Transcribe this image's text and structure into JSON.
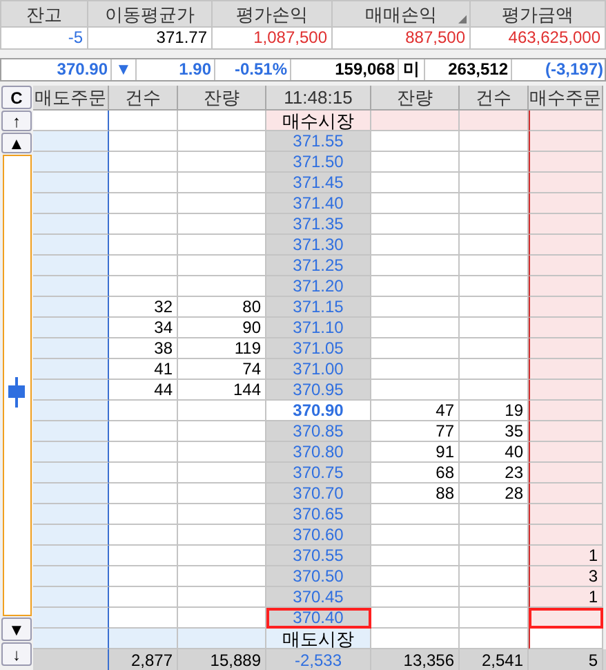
{
  "position": {
    "columns": [
      "잔고",
      "이동평균가",
      "평가손익",
      "매매손익",
      "평가금액"
    ],
    "values": [
      {
        "text": "-5",
        "color": "#2f6fe0"
      },
      {
        "text": "371.77",
        "color": "#000000"
      },
      {
        "text": "1,087,500",
        "color": "#e03030"
      },
      {
        "text": "887,500",
        "color": "#e03030"
      },
      {
        "text": "463,625,000",
        "color": "#e03030"
      }
    ]
  },
  "quote_bar": [
    {
      "text": "370.90",
      "color": "#2f6fe0"
    },
    {
      "text": "▼",
      "color": "#2f6fe0"
    },
    {
      "text": "1.90",
      "color": "#2f6fe0"
    },
    {
      "text": "-0.51%",
      "color": "#2f6fe0"
    },
    {
      "text": "159,068",
      "color": "#000000"
    },
    {
      "text": "미",
      "color": "#000000"
    },
    {
      "text": "263,512",
      "color": "#000000"
    },
    {
      "text": "(-3,197)",
      "color": "#2f6fe0"
    }
  ],
  "order_book": {
    "buttons": [
      "C",
      "↑",
      "▲",
      "▼",
      "↓"
    ],
    "columns": [
      "매도주문",
      "건수",
      "잔량",
      "11:48:15",
      "잔량",
      "건수",
      "매수주문"
    ],
    "rows": [
      {
        "kind": "market_buy",
        "price": "매수시장"
      },
      {
        "kind": "price",
        "price": "371.55",
        "current": false,
        "highlighted": false
      },
      {
        "kind": "price",
        "price": "371.50",
        "current": false,
        "highlighted": false
      },
      {
        "kind": "price",
        "price": "371.45",
        "current": false,
        "highlighted": false
      },
      {
        "kind": "price",
        "price": "371.40",
        "current": false,
        "highlighted": false
      },
      {
        "kind": "price",
        "price": "371.35",
        "current": false,
        "highlighted": false
      },
      {
        "kind": "price",
        "price": "371.30",
        "current": false,
        "highlighted": false
      },
      {
        "kind": "price",
        "price": "371.25",
        "current": false,
        "highlighted": false
      },
      {
        "kind": "price",
        "price": "371.20",
        "current": false,
        "highlighted": false
      },
      {
        "kind": "price",
        "left_count": "32",
        "left_qty": "80",
        "price": "371.15",
        "current": false,
        "highlighted": false
      },
      {
        "kind": "price",
        "left_count": "34",
        "left_qty": "90",
        "price": "371.10",
        "current": false,
        "highlighted": false
      },
      {
        "kind": "price",
        "left_count": "38",
        "left_qty": "119",
        "price": "371.05",
        "current": false,
        "highlighted": false
      },
      {
        "kind": "price",
        "left_count": "41",
        "left_qty": "74",
        "price": "371.00",
        "current": false,
        "highlighted": false
      },
      {
        "kind": "price",
        "left_count": "44",
        "left_qty": "144",
        "price": "370.95",
        "current": false,
        "highlighted": false
      },
      {
        "kind": "price",
        "price": "370.90",
        "right_qty": "47",
        "right_count": "19",
        "current": true,
        "highlighted": false
      },
      {
        "kind": "price",
        "price": "370.85",
        "right_qty": "77",
        "right_count": "35",
        "current": false,
        "highlighted": false
      },
      {
        "kind": "price",
        "price": "370.80",
        "right_qty": "91",
        "right_count": "40",
        "current": false,
        "highlighted": false
      },
      {
        "kind": "price",
        "price": "370.75",
        "right_qty": "68",
        "right_count": "23",
        "current": false,
        "highlighted": false
      },
      {
        "kind": "price",
        "price": "370.70",
        "right_qty": "88",
        "right_count": "28",
        "current": false,
        "highlighted": false
      },
      {
        "kind": "price",
        "price": "370.65",
        "current": false,
        "highlighted": false
      },
      {
        "kind": "price",
        "price": "370.60",
        "current": false,
        "highlighted": false
      },
      {
        "kind": "price",
        "price": "370.55",
        "buy_order": "1",
        "current": false,
        "highlighted": false
      },
      {
        "kind": "price",
        "price": "370.50",
        "buy_order": "3",
        "current": false,
        "highlighted": false
      },
      {
        "kind": "price",
        "price": "370.45",
        "buy_order": "1",
        "current": false,
        "highlighted": false
      },
      {
        "kind": "price",
        "price": "370.40",
        "current": false,
        "highlighted": true
      },
      {
        "kind": "market_sell",
        "price": "매도시장"
      }
    ],
    "totals": [
      "2,877",
      "15,889",
      "-2,533",
      "13,356",
      "2,541",
      "5"
    ]
  }
}
